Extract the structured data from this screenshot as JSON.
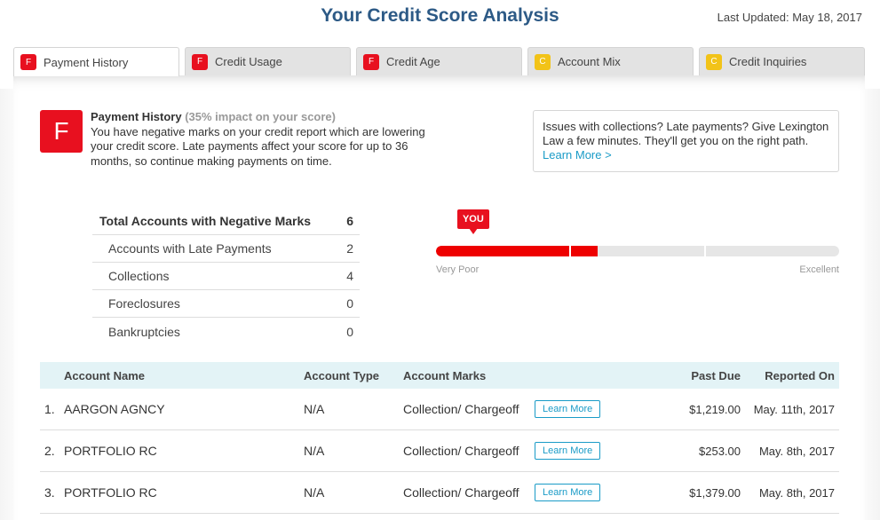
{
  "header": {
    "title": "Your Credit Score Analysis",
    "last_updated": "Last Updated: May 18, 2017"
  },
  "tabs": [
    {
      "grade": "F",
      "label": "Payment History",
      "active": true
    },
    {
      "grade": "F",
      "label": "Credit Usage",
      "active": false
    },
    {
      "grade": "F",
      "label": "Credit Age",
      "active": false
    },
    {
      "grade": "C",
      "label": "Account Mix",
      "active": false
    },
    {
      "grade": "C",
      "label": "Credit Inquiries",
      "active": false
    }
  ],
  "summary": {
    "grade": "F",
    "title": "Payment History",
    "impact": "(35% impact on your score)",
    "text": "You have negative marks on your credit report which are lowering your credit score. Late payments affect your score for up to 36 months, so continue making payments on time."
  },
  "promo": {
    "text": "Issues with collections? Late payments? Give Lexington Law a few minutes. They'll get you on the right path.",
    "link": "Learn More >"
  },
  "counts": [
    {
      "label": "Total Accounts with Negative Marks",
      "value": "6"
    },
    {
      "label": "Accounts with Late Payments",
      "value": "2"
    },
    {
      "label": "Collections",
      "value": "4"
    },
    {
      "label": "Foreclosures",
      "value": "0"
    },
    {
      "label": "Bankruptcies",
      "value": "0"
    }
  ],
  "gauge": {
    "badge": "YOU",
    "min_label": "Very Poor",
    "max_label": "Excellent",
    "level": 0.4,
    "segments": 3
  },
  "table": {
    "headers": {
      "name": "Account Name",
      "type": "Account Type",
      "marks": "Account Marks",
      "past_due": "Past Due",
      "reported": "Reported On"
    },
    "learn_label": "Learn More",
    "rows": [
      {
        "num": "1.",
        "name": "AARGON AGNCY",
        "type": "N/A",
        "marks": "Collection/ Chargeoff",
        "past_due": "$1,219.00",
        "reported": "May. 11th, 2017"
      },
      {
        "num": "2.",
        "name": "PORTFOLIO RC",
        "type": "N/A",
        "marks": "Collection/ Chargeoff",
        "past_due": "$253.00",
        "reported": "May. 8th, 2017"
      },
      {
        "num": "3.",
        "name": "PORTFOLIO RC",
        "type": "N/A",
        "marks": "Collection/ Chargeoff",
        "past_due": "$1,379.00",
        "reported": "May. 8th, 2017"
      }
    ]
  },
  "colors": {
    "title": "#2d5a86",
    "grade_f": "#e8101f",
    "grade_c": "#f2c318",
    "link": "#1a9bc7",
    "bar_fill": "#ee0000"
  }
}
